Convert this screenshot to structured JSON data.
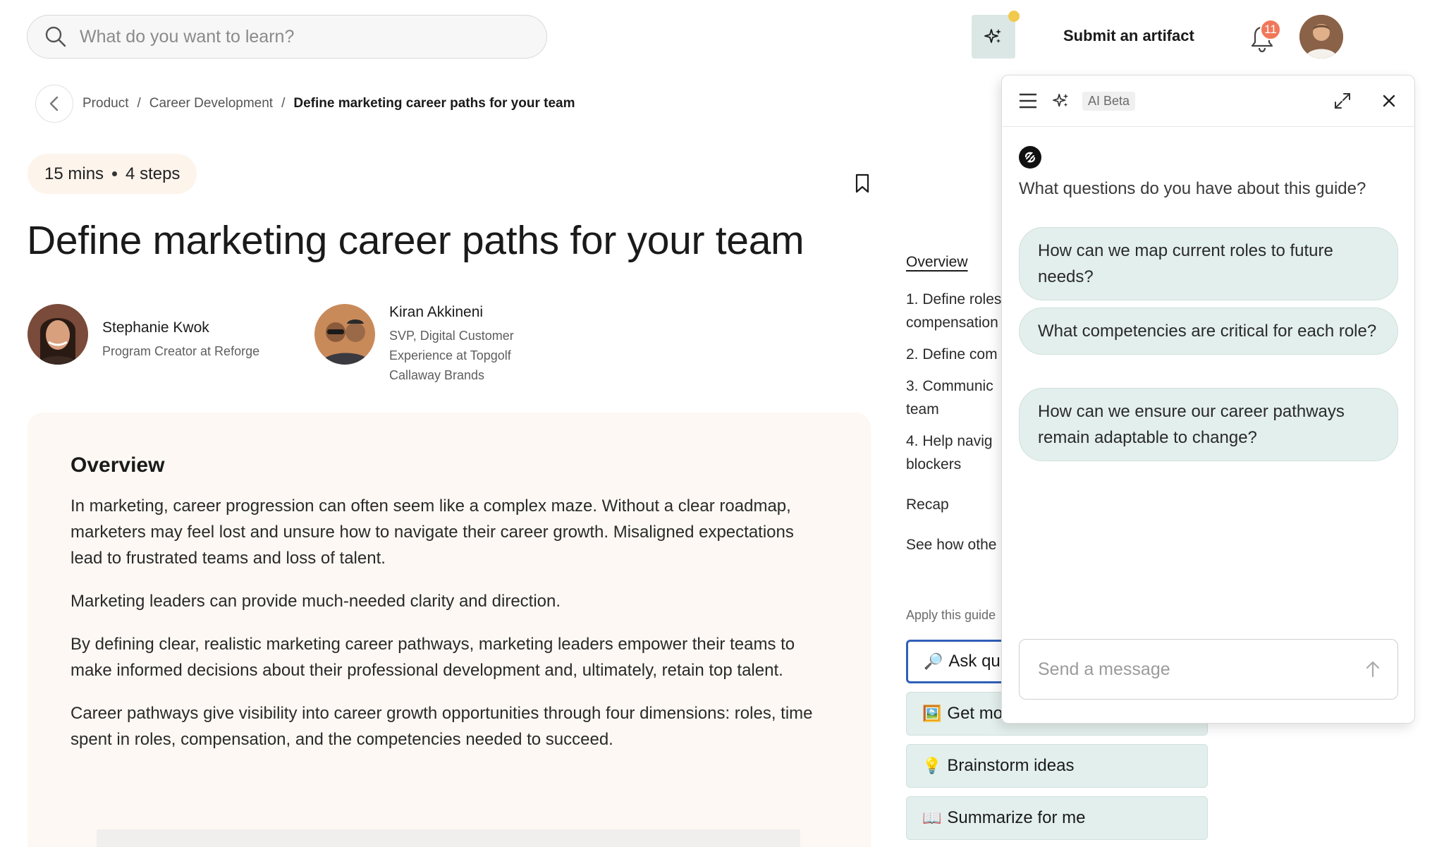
{
  "search": {
    "placeholder": "What do you want to learn?"
  },
  "header": {
    "submit_label": "Submit an artifact",
    "notification_count": "11"
  },
  "breadcrumb": {
    "items": [
      "Product",
      "Career Development",
      "Define marketing career paths for your team"
    ]
  },
  "guide": {
    "duration": "15 mins",
    "steps": "4 steps",
    "title": "Define marketing career paths for your team"
  },
  "authors": [
    {
      "name": "Stephanie Kwok",
      "role": "Program Creator at Reforge"
    },
    {
      "name": "Kiran Akkineni",
      "role_lines": [
        "SVP, Digital Customer",
        "Experience at Topgolf",
        "Callaway Brands"
      ]
    }
  ],
  "overview": {
    "heading": "Overview",
    "paragraphs": [
      "In marketing, career progression can often seem like a complex maze. Without a clear roadmap, marketers may feel lost and unsure how to navigate their career growth. Misaligned expectations lead to frustrated teams and loss of talent.",
      "Marketing leaders can provide much-needed clarity and direction.",
      "By defining clear, realistic marketing career pathways, marketing leaders empower their teams to make informed decisions about their professional development and, ultimately, retain top talent.",
      "Career pathways give visibility into career growth opportunities through four dimensions: roles, time spent in roles, compensation, and the competencies needed to succeed."
    ]
  },
  "toc": {
    "items": [
      "Overview",
      "1. Define roles",
      "compensation",
      "2. Define com",
      "3. Communic",
      "team",
      "4. Help navig",
      "blockers",
      "Recap",
      "See how othe"
    ],
    "apply_label": "Apply this guide"
  },
  "actions": [
    {
      "emoji": "🔎",
      "label": "Ask qu"
    },
    {
      "emoji": "🖼️",
      "label": "Get mo"
    },
    {
      "emoji": "💡",
      "label": "Brainstorm ideas"
    },
    {
      "emoji": "📖",
      "label": "Summarize for me"
    }
  ],
  "ai_panel": {
    "badge": "AI Beta",
    "question": "What questions do you have about this guide?",
    "suggestions": [
      "How can we map current roles to future needs?",
      "What competencies are critical for each role?",
      "How can we ensure our career pathways remain adaptable to change?"
    ],
    "message_placeholder": "Send a message"
  },
  "colors": {
    "accent_green": "#e3efec",
    "card_bg": "#fdf8f3",
    "badge": "#f0785a",
    "selected_border": "#2f5fb8"
  }
}
